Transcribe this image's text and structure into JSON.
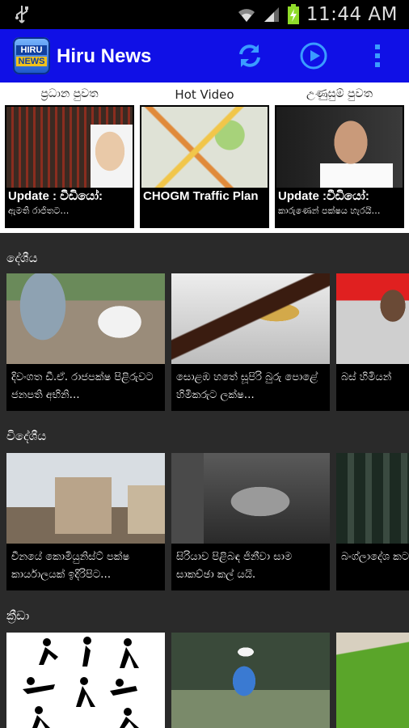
{
  "status": {
    "time": "11:44 AM"
  },
  "app": {
    "title": "Hiru News",
    "logo_line1": "HIRU",
    "logo_line2": "NEWS",
    "accent": "#1010e6"
  },
  "top_tabs": [
    "ප්‍රධාන පුවත",
    "Hot Video",
    "උණුසුම් පුවත"
  ],
  "featured": [
    {
      "title": "Update : වීඩියෝ:",
      "subtitle": "ඇමති රාජිතට…"
    },
    {
      "title": "CHOGM Traffic Plan",
      "subtitle": ""
    },
    {
      "title": "Update :වීඩියෝ:",
      "subtitle": "කාරුණෙන් පක්ෂය හැරයි…"
    }
  ],
  "sections": [
    {
      "title": "දේශීය",
      "items": [
        {
          "caption": "දිවංගත ඩී.ඒ. රාජපක්ෂ පිළිරුවට ජනපති අභිනි…"
        },
        {
          "caption": "සොළඹ හතේ සූපිරි බුරු පොළේ හිමිකරුට ලක්ෂ…"
        },
        {
          "caption": "බස් හිමියන්"
        }
      ]
    },
    {
      "title": "විදේශීය",
      "items": [
        {
          "caption": "චීනයේ කොමියුනිස්ට් පක්ෂ කාර්යාලයක් ඉදිරිපිට…"
        },
        {
          "caption": "සිරියාව පිළිබඳ ජිනීවා සාම සාකච්ඡා කල් යයි."
        },
        {
          "caption": "බංග්ලාදේශ කට මරණ දඬ"
        }
      ]
    },
    {
      "title": "ක්‍රීඩා",
      "items": [
        {
          "caption": ""
        },
        {
          "caption": ""
        },
        {
          "caption": ""
        }
      ]
    }
  ]
}
